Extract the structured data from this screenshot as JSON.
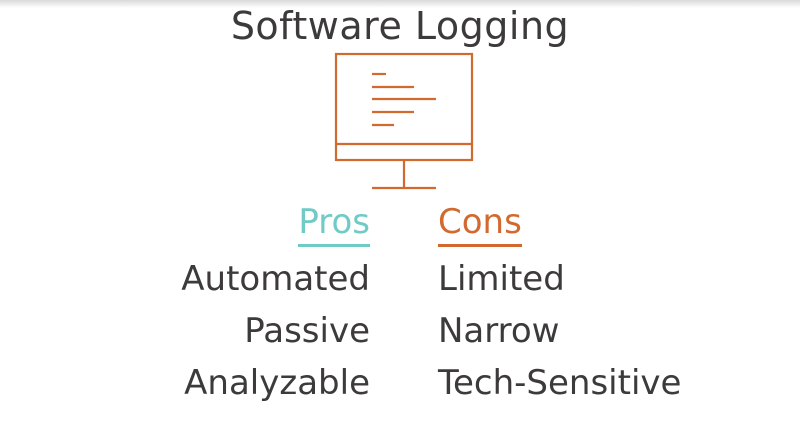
{
  "title": "Software Logging",
  "colors": {
    "text": "#3d3a3b",
    "pros": "#6fcbc6",
    "cons": "#d2692f",
    "monitor": "#d2692f"
  },
  "icon": "computer-monitor-with-log-lines-icon",
  "pros": {
    "heading": "Pros",
    "items": [
      "Automated",
      "Passive",
      "Analyzable"
    ]
  },
  "cons": {
    "heading": "Cons",
    "items": [
      "Limited",
      "Narrow",
      "Tech-Sensitive"
    ]
  }
}
